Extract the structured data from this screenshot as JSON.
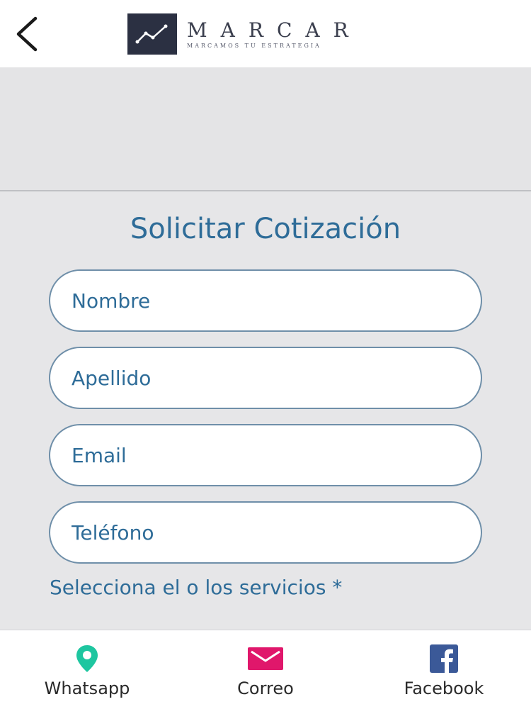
{
  "header": {
    "logo": {
      "name": "MARCAR",
      "tagline": "MARCAMOS TU ESTRATEGIA"
    }
  },
  "form": {
    "title": "Solicitar Cotización",
    "fields": {
      "first_name": {
        "value": "",
        "placeholder": "Nombre"
      },
      "last_name": {
        "value": "",
        "placeholder": "Apellido"
      },
      "email": {
        "value": "",
        "placeholder": "Email"
      },
      "phone": {
        "value": "",
        "placeholder": "Teléfono"
      }
    },
    "services_label": "Selecciona el o los servicios *"
  },
  "bottom_nav": {
    "items": [
      {
        "label": "Whatsapp",
        "icon": "location-pin-icon",
        "color": "#1ec6a0"
      },
      {
        "label": "Correo",
        "icon": "mail-icon",
        "color": "#e0176b"
      },
      {
        "label": "Facebook",
        "icon": "facebook-icon",
        "color": "#3b5998"
      }
    ]
  },
  "colors": {
    "accent": "#2e6c98",
    "background": "#e6e6e8",
    "logo_box": "#2b3042"
  }
}
